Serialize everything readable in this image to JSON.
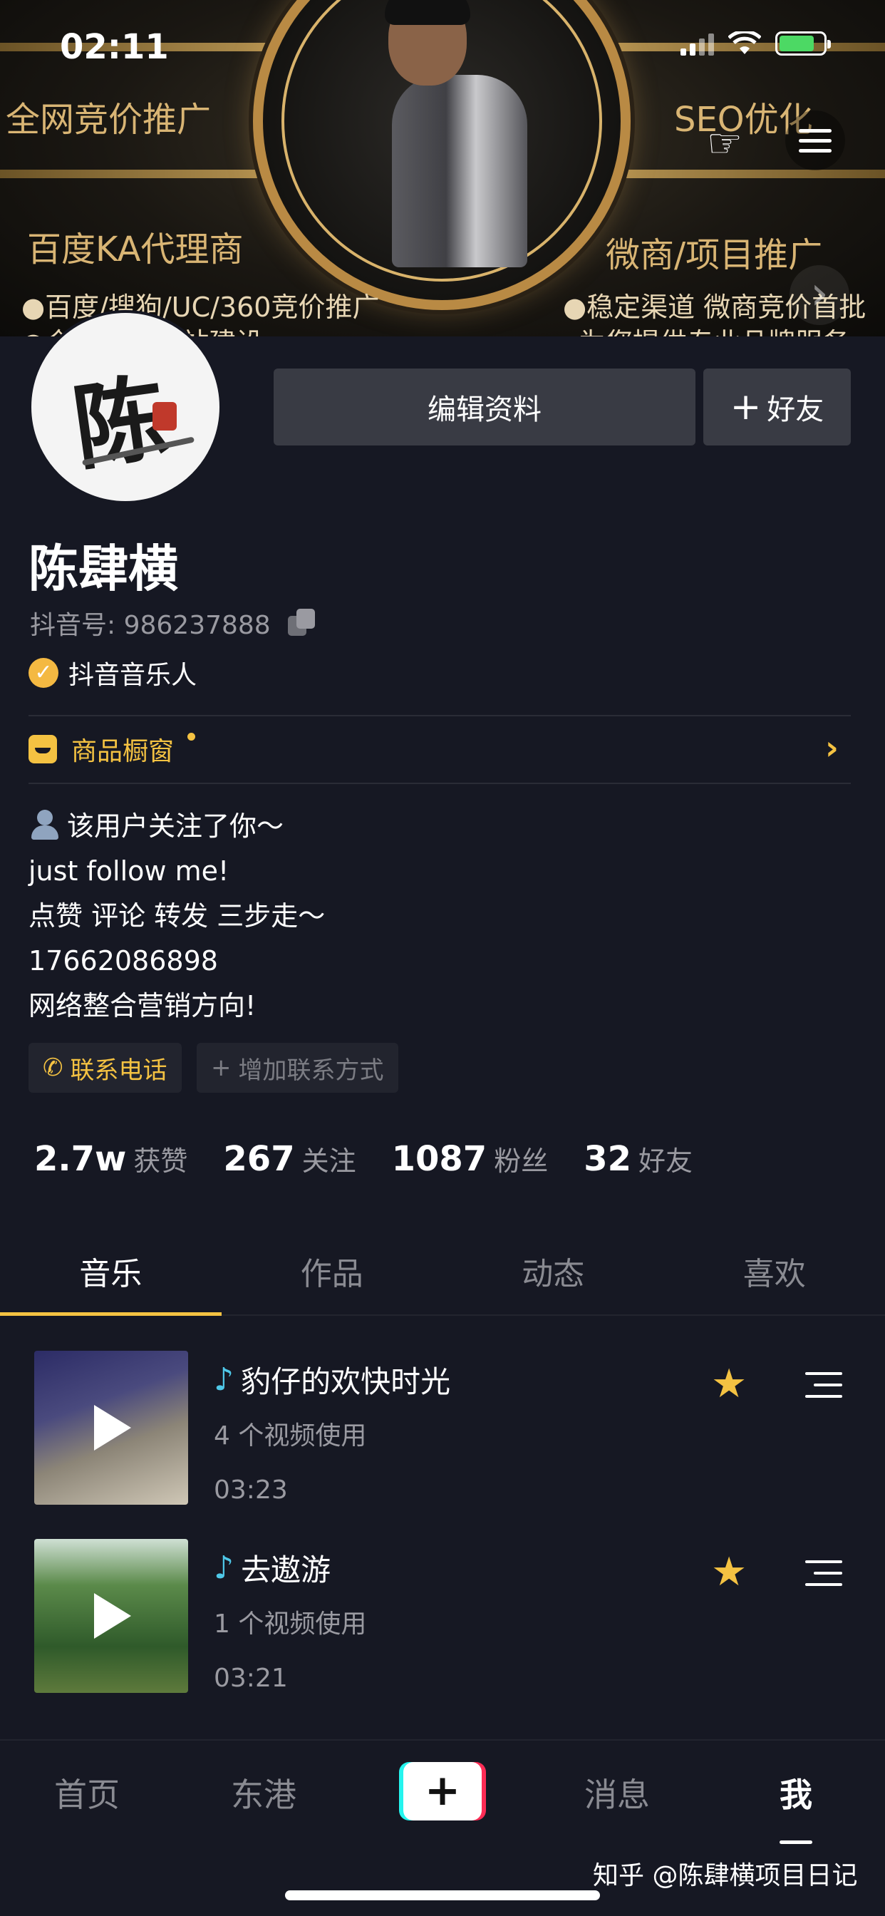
{
  "status_bar": {
    "time": "02:11"
  },
  "banner": {
    "left_top": "全网竞价推广",
    "right_top": "SEO优化",
    "left_mid": "百度KA代理商",
    "right_mid": "微商/项目推广",
    "left_small": "●百度/搜狗/UC/360竞价推广",
    "right_small": "●稳定渠道 微商竞价首批",
    "left_small2": "●企业SEO网站建设",
    "right_small2": "为您提供专业品牌服务"
  },
  "profile": {
    "edit_button": "编辑资料",
    "friend_button": "好友",
    "name": "陈肆横",
    "douyin_id": "抖音号: 986237888",
    "verified_label": "抖音音乐人",
    "shop_label": "商品橱窗",
    "bio": [
      "该用户关注了你～",
      "just follow me!",
      "点赞 评论 转发 三步走～",
      "17662086898",
      "网络整合营销方向!"
    ],
    "contact_phone": "联系电话",
    "contact_add": "增加联系方式"
  },
  "stats": [
    {
      "value": "2.7w",
      "label": "获赞"
    },
    {
      "value": "267",
      "label": "关注"
    },
    {
      "value": "1087",
      "label": "粉丝"
    },
    {
      "value": "32",
      "label": "好友"
    }
  ],
  "tabs": [
    "音乐",
    "作品",
    "动态",
    "喜欢"
  ],
  "songs": [
    {
      "title": "豹仔的欢快时光",
      "usage": "4 个视频使用",
      "duration": "03:23"
    },
    {
      "title": "去遨游",
      "usage": "1 个视频使用",
      "duration": "03:21"
    }
  ],
  "nav": {
    "home": "首页",
    "local": "东港",
    "plus": "+",
    "messages": "消息",
    "me": "我"
  },
  "watermark": "知乎 @陈肆横项目日记",
  "colors": {
    "background": "#161823",
    "accent": "#f4c242",
    "note": "#4fc8e8"
  },
  "icons": [
    "signal-icon",
    "wifi-icon",
    "battery-icon",
    "hand-pointer-icon",
    "menu-icon",
    "chevron-right-icon",
    "copy-icon",
    "verified-icon",
    "shop-icon",
    "phone-icon",
    "plus-icon",
    "music-note-icon",
    "star-icon",
    "playlist-icon",
    "play-icon"
  ]
}
